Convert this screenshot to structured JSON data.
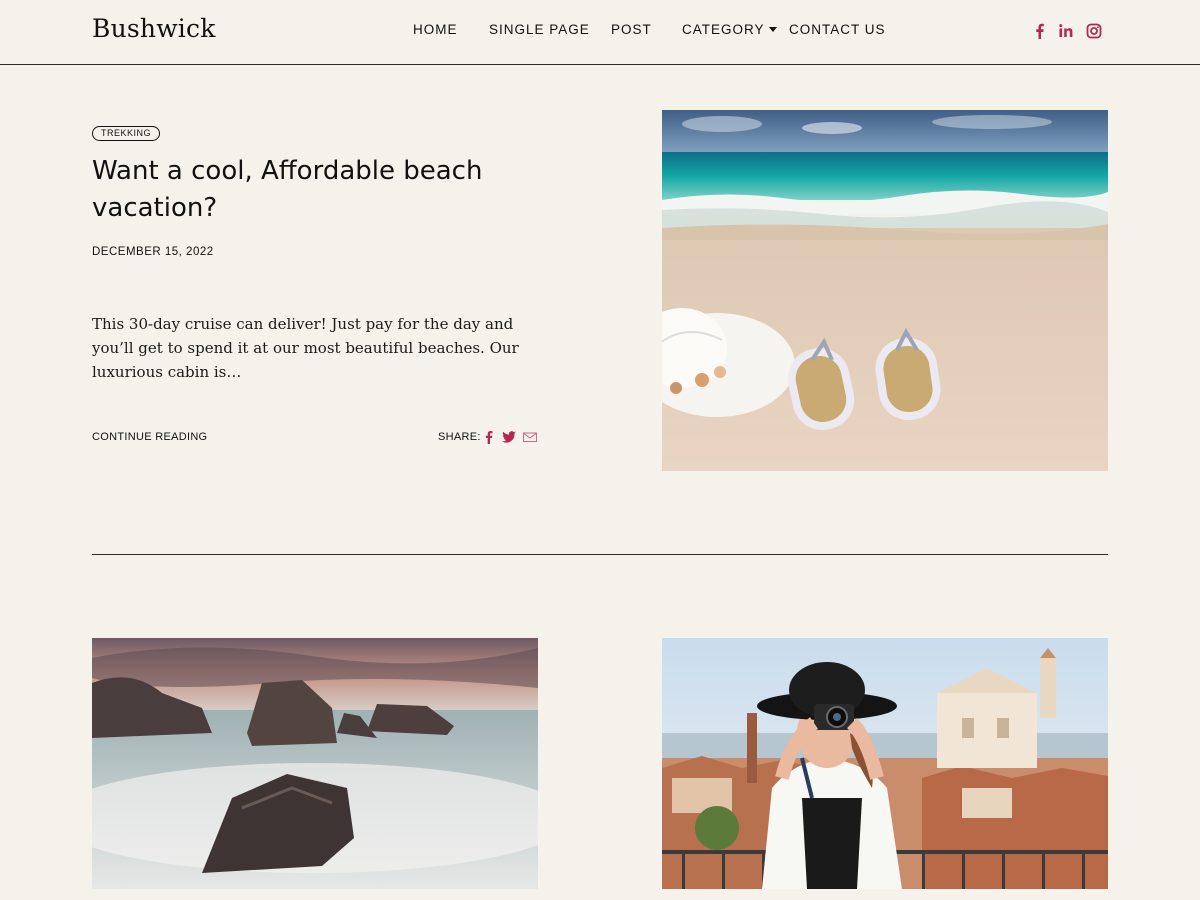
{
  "site": {
    "logo": "Bushwick"
  },
  "nav": {
    "items": [
      {
        "label": "HOME"
      },
      {
        "label": "SINGLE PAGE"
      },
      {
        "label": "POST"
      },
      {
        "label": "CATEGORY"
      },
      {
        "label": "CONTACT US"
      }
    ]
  },
  "social": {
    "icons": [
      "facebook-icon",
      "linkedin-icon",
      "instagram-icon"
    ],
    "color": "#b5274f"
  },
  "featured": {
    "tag": "TREKKING",
    "title": "Want a cool, Affordable beach vacation?",
    "date": "DECEMBER 15, 2022",
    "excerpt": "This 30-day cruise can deliver! Just pay for the day and you’ll get to spend it at our most beautiful beaches. Our luxurious cabin is…",
    "continue_label": "CONTINUE READING",
    "share_label": "SHARE:",
    "share_icons": [
      "facebook-icon",
      "twitter-icon",
      "email-icon"
    ]
  },
  "images": {
    "featured": "beach-sandals-hat-photo",
    "grid": [
      "rocky-coast-photo",
      "woman-with-camera-photo"
    ]
  },
  "colors": {
    "background": "#f4f2eb",
    "accent": "#b5274f",
    "text": "#111111"
  }
}
